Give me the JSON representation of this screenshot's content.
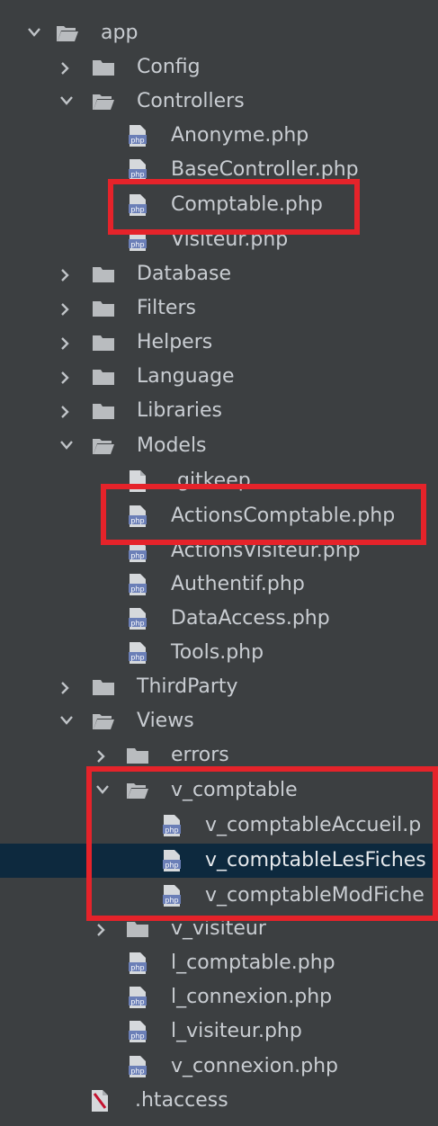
{
  "tree": {
    "root": {
      "label": "app",
      "expanded": true
    },
    "app_children": [
      {
        "label": "Config",
        "type": "folder",
        "expanded": false
      },
      {
        "label": "Controllers",
        "type": "folder",
        "expanded": true
      },
      {
        "label": "Anonyme.php",
        "type": "php"
      },
      {
        "label": "BaseController.php",
        "type": "php"
      },
      {
        "label": "Comptable.php",
        "type": "php"
      },
      {
        "label": "Visiteur.php",
        "type": "php"
      },
      {
        "label": "Database",
        "type": "folder",
        "expanded": false
      },
      {
        "label": "Filters",
        "type": "folder",
        "expanded": false
      },
      {
        "label": "Helpers",
        "type": "folder",
        "expanded": false
      },
      {
        "label": "Language",
        "type": "folder",
        "expanded": false
      },
      {
        "label": "Libraries",
        "type": "folder",
        "expanded": false
      },
      {
        "label": "Models",
        "type": "folder",
        "expanded": true
      },
      {
        "label": ".gitkeep",
        "type": "file"
      },
      {
        "label": "ActionsComptable.php",
        "type": "php"
      },
      {
        "label": "ActionsVisiteur.php",
        "type": "php"
      },
      {
        "label": "Authentif.php",
        "type": "php"
      },
      {
        "label": "DataAccess.php",
        "type": "php"
      },
      {
        "label": "Tools.php",
        "type": "php"
      },
      {
        "label": "ThirdParty",
        "type": "folder",
        "expanded": false
      },
      {
        "label": "Views",
        "type": "folder",
        "expanded": true
      },
      {
        "label": "errors",
        "type": "folder",
        "expanded": false
      },
      {
        "label": "v_comptable",
        "type": "folder",
        "expanded": true
      },
      {
        "label": "v_comptableAccueil.p",
        "type": "php"
      },
      {
        "label": "v_comptableLesFiches",
        "type": "php",
        "selected": true
      },
      {
        "label": "v_comptableModFiche",
        "type": "php"
      },
      {
        "label": "v_visiteur",
        "type": "folder",
        "expanded": false
      },
      {
        "label": "l_comptable.php",
        "type": "php"
      },
      {
        "label": "l_connexion.php",
        "type": "php"
      },
      {
        "label": "l_visiteur.php",
        "type": "php"
      },
      {
        "label": "v_connexion.php",
        "type": "php"
      },
      {
        "label": ".htaccess",
        "type": "htaccess"
      }
    ]
  },
  "colors": {
    "background": "#3c3f41",
    "selected_row": "#0d293e",
    "text": "#c9cdd2",
    "highlight": "#e5232a",
    "folder": "#b9bcbf",
    "php_badge": "#6b7fb7"
  },
  "icons": {
    "folder_closed": "folder-icon",
    "folder_open": "folder-open-icon",
    "php_file": "php-file-icon",
    "generic_file": "file-icon",
    "htaccess_file": "htaccess-icon",
    "expand": "chevron-right-icon",
    "collapse": "chevron-down-icon"
  }
}
